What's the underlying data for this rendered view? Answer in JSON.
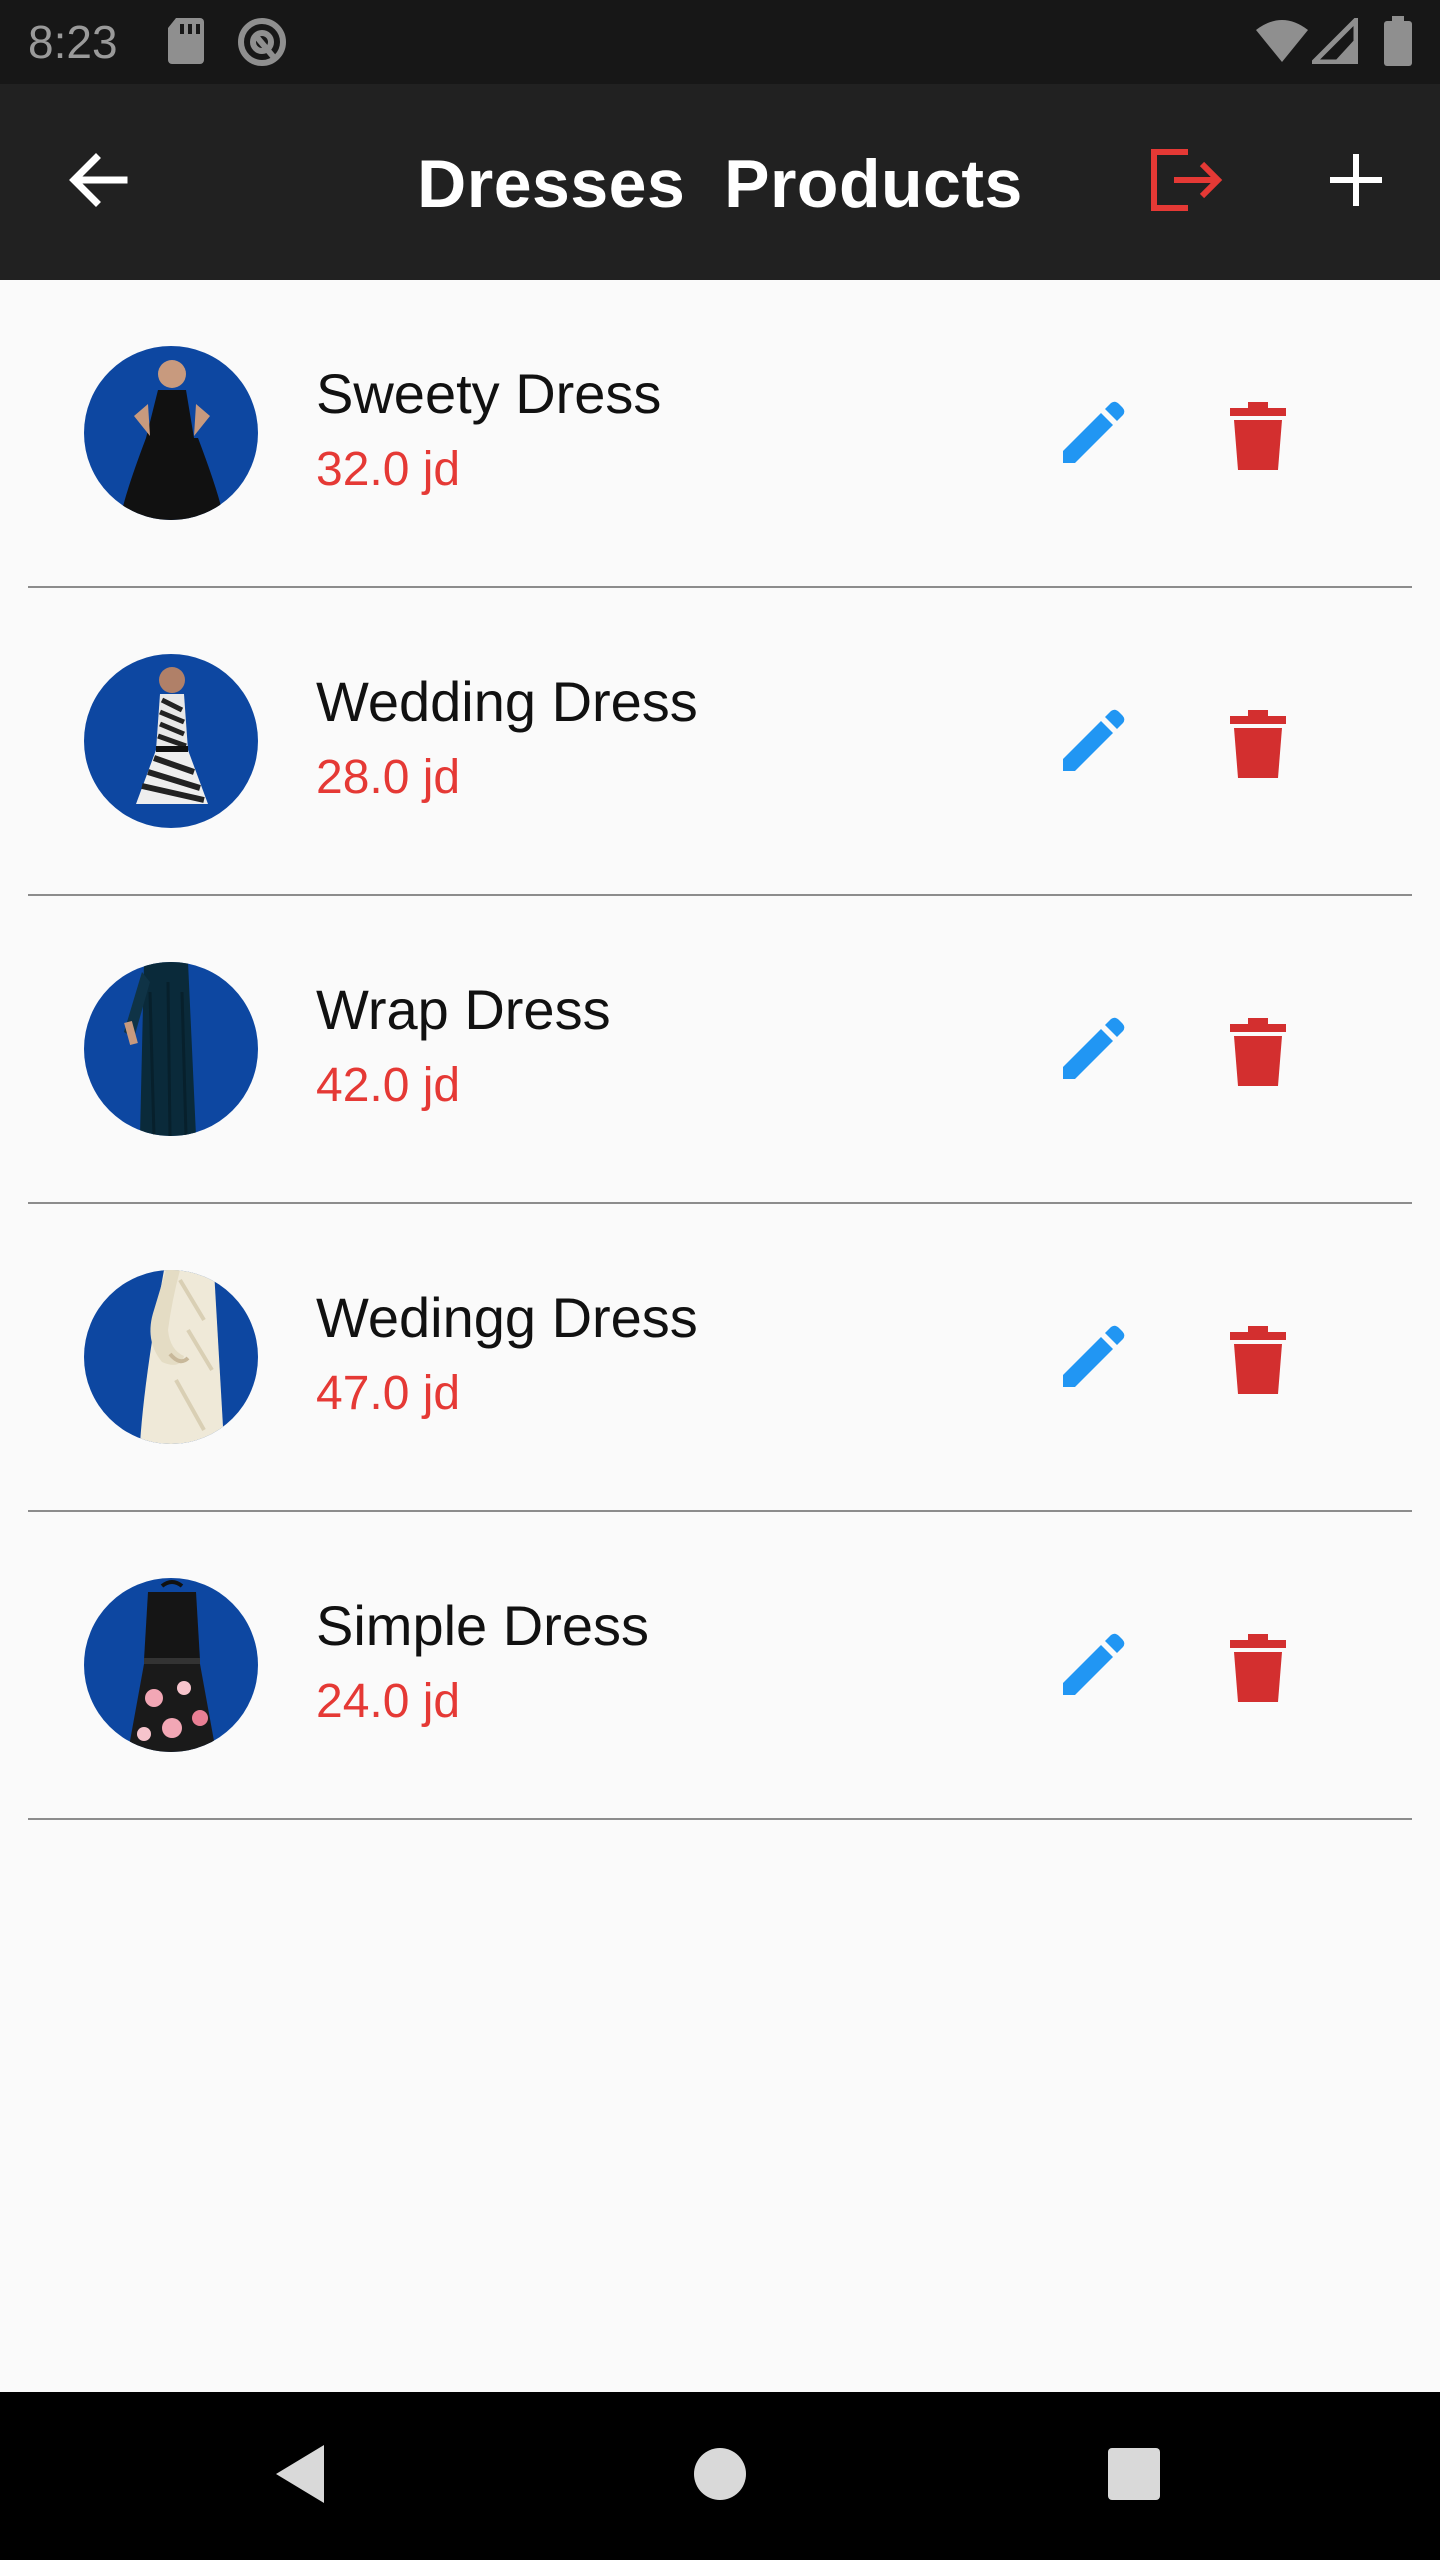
{
  "status_bar": {
    "time": "8:23",
    "icons": [
      "sd-card-icon",
      "sync-icon",
      "wifi-icon",
      "signal-icon",
      "battery-icon"
    ]
  },
  "app_bar": {
    "title": "Dresses  Products",
    "back_icon": "arrow-back-icon",
    "logout_icon": "logout-icon",
    "add_icon": "plus-icon"
  },
  "products": [
    {
      "name": "Sweety Dress",
      "price": "32.0 jd"
    },
    {
      "name": "Wedding Dress",
      "price": "28.0 jd"
    },
    {
      "name": "Wrap Dress",
      "price": "42.0 jd"
    },
    {
      "name": "Wedingg Dress",
      "price": "47.0 jd"
    },
    {
      "name": "Simple Dress",
      "price": "24.0 jd"
    }
  ],
  "colors": {
    "app_bar": "#212121",
    "status_bar": "#171717",
    "price": "#e53935",
    "edit_icon": "#2196f3",
    "delete_icon": "#d32f2f",
    "avatar_bg": "#0d47a1",
    "background": "#fafafa"
  },
  "nav_bar": {
    "icons": [
      "back-triangle-icon",
      "home-circle-icon",
      "recents-square-icon"
    ]
  }
}
